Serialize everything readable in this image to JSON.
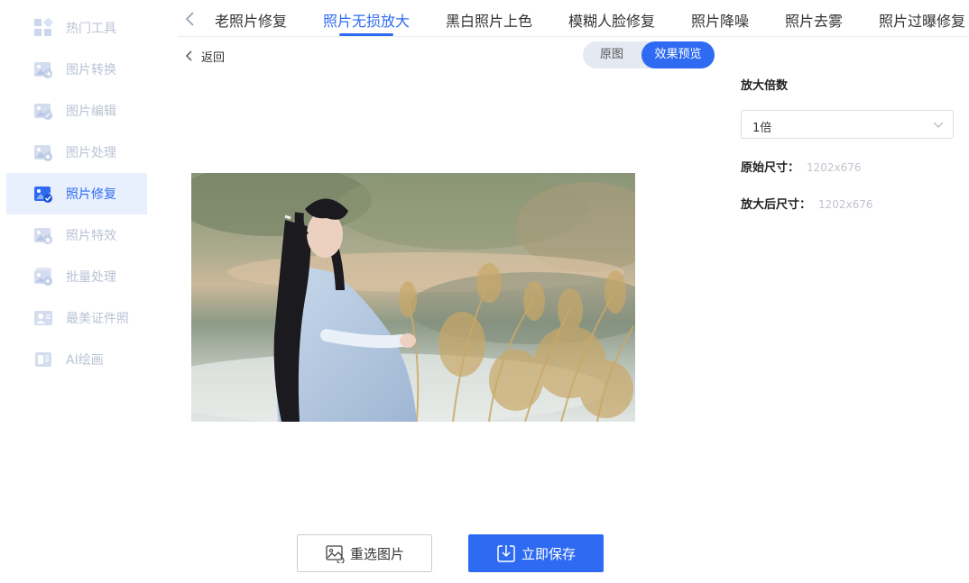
{
  "sidebar": {
    "items": [
      {
        "label": "热门工具",
        "icon": "grid-icon"
      },
      {
        "label": "图片转换",
        "icon": "image-convert-icon"
      },
      {
        "label": "图片编辑",
        "icon": "image-edit-icon"
      },
      {
        "label": "图片处理",
        "icon": "image-process-icon"
      },
      {
        "label": "照片修复",
        "icon": "photo-repair-icon"
      },
      {
        "label": "照片特效",
        "icon": "photo-effect-icon"
      },
      {
        "label": "批量处理",
        "icon": "batch-icon"
      },
      {
        "label": "最美证件照",
        "icon": "id-photo-icon"
      },
      {
        "label": "AI绘画",
        "icon": "ai-paint-icon"
      }
    ],
    "active_index": 4
  },
  "tabs": {
    "items": [
      "老照片修复",
      "照片无损放大",
      "黑白照片上色",
      "模糊人脸修复",
      "照片降噪",
      "照片去雾",
      "照片过曝修复"
    ],
    "active_index": 1
  },
  "back_label": "返回",
  "view_toggle": {
    "original": "原图",
    "preview": "效果预览",
    "selected": "preview"
  },
  "settings": {
    "scale_title": "放大倍数",
    "scale_value": "1倍",
    "original_size_label": "原始尺寸：",
    "original_size_value": "1202x676",
    "scaled_size_label": "放大后尺寸：",
    "scaled_size_value": "1202x676"
  },
  "buttons": {
    "reselect": "重选图片",
    "save": "立即保存"
  },
  "colors": {
    "accent": "#2f6bf2",
    "sidebar_inactive": "#b9c3d4",
    "active_bg": "#e8f0fe"
  }
}
